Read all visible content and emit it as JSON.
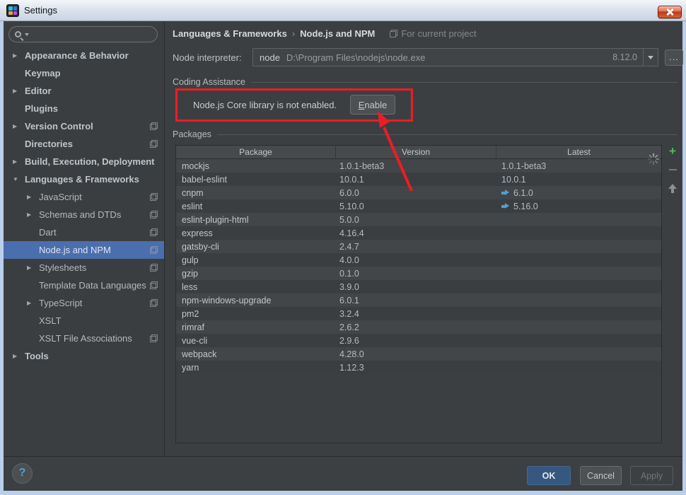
{
  "window": {
    "title": "Settings"
  },
  "sidebar": {
    "items": [
      {
        "label": "Appearance & Behavior",
        "level": 0,
        "bold": true,
        "arrow": "right"
      },
      {
        "label": "Keymap",
        "level": 0,
        "bold": true
      },
      {
        "label": "Editor",
        "level": 0,
        "bold": true,
        "arrow": "right"
      },
      {
        "label": "Plugins",
        "level": 0,
        "bold": true
      },
      {
        "label": "Version Control",
        "level": 0,
        "bold": true,
        "arrow": "right",
        "badge": true
      },
      {
        "label": "Directories",
        "level": 0,
        "bold": true,
        "badge": true
      },
      {
        "label": "Build, Execution, Deployment",
        "level": 0,
        "bold": true,
        "arrow": "right"
      },
      {
        "label": "Languages & Frameworks",
        "level": 0,
        "bold": true,
        "arrow": "down"
      },
      {
        "label": "JavaScript",
        "level": 1,
        "arrow": "right",
        "badge": true
      },
      {
        "label": "Schemas and DTDs",
        "level": 1,
        "arrow": "right",
        "badge": true
      },
      {
        "label": "Dart",
        "level": 1,
        "badge": true
      },
      {
        "label": "Node.js and NPM",
        "level": 1,
        "badge": true,
        "selected": true
      },
      {
        "label": "Stylesheets",
        "level": 1,
        "arrow": "right",
        "badge": true
      },
      {
        "label": "Template Data Languages",
        "level": 1,
        "badge": true
      },
      {
        "label": "TypeScript",
        "level": 1,
        "arrow": "right",
        "badge": true
      },
      {
        "label": "XSLT",
        "level": 1
      },
      {
        "label": "XSLT File Associations",
        "level": 1,
        "badge": true
      },
      {
        "label": "Tools",
        "level": 0,
        "bold": true,
        "arrow": "right"
      }
    ]
  },
  "header": {
    "breadcrumb1": "Languages & Frameworks",
    "separator": "›",
    "breadcrumb2": "Node.js and NPM",
    "scope_note": "For current project"
  },
  "interpreter": {
    "label": "Node interpreter:",
    "name": "node",
    "path": "D:\\Program Files\\nodejs\\node.exe",
    "version": "8.12.0",
    "browse": "..."
  },
  "coding_assistance": {
    "section": "Coding Assistance",
    "message": "Node.js Core library is not enabled.",
    "enable_underline": "E",
    "enable_rest": "nable"
  },
  "packages": {
    "section": "Packages",
    "columns": [
      "Package",
      "Version",
      "Latest"
    ],
    "rows": [
      {
        "package": "mockjs",
        "version": "1.0.1-beta3",
        "latest": "1.0.1-beta3",
        "upgrade": false
      },
      {
        "package": "babel-eslint",
        "version": "10.0.1",
        "latest": "10.0.1",
        "upgrade": false
      },
      {
        "package": "cnpm",
        "version": "6.0.0",
        "latest": "6.1.0",
        "upgrade": true
      },
      {
        "package": "eslint",
        "version": "5.10.0",
        "latest": "5.16.0",
        "upgrade": true
      },
      {
        "package": "eslint-plugin-html",
        "version": "5.0.0",
        "latest": "",
        "upgrade": false
      },
      {
        "package": "express",
        "version": "4.16.4",
        "latest": "",
        "upgrade": false
      },
      {
        "package": "gatsby-cli",
        "version": "2.4.7",
        "latest": "",
        "upgrade": false
      },
      {
        "package": "gulp",
        "version": "4.0.0",
        "latest": "",
        "upgrade": false
      },
      {
        "package": "gzip",
        "version": "0.1.0",
        "latest": "",
        "upgrade": false
      },
      {
        "package": "less",
        "version": "3.9.0",
        "latest": "",
        "upgrade": false
      },
      {
        "package": "npm-windows-upgrade",
        "version": "6.0.1",
        "latest": "",
        "upgrade": false
      },
      {
        "package": "pm2",
        "version": "3.2.4",
        "latest": "",
        "upgrade": false
      },
      {
        "package": "rimraf",
        "version": "2.6.2",
        "latest": "",
        "upgrade": false
      },
      {
        "package": "vue-cli",
        "version": "2.9.6",
        "latest": "",
        "upgrade": false
      },
      {
        "package": "webpack",
        "version": "4.28.0",
        "latest": "",
        "upgrade": false
      },
      {
        "package": "yarn",
        "version": "1.12.3",
        "latest": "",
        "upgrade": false
      }
    ]
  },
  "footer": {
    "help": "?",
    "ok": "OK",
    "cancel": "Cancel",
    "apply": "Apply"
  },
  "colors": {
    "selection": "#4b6eaf",
    "annotation_red": "#ee1c25",
    "ok_blue": "#365880",
    "upgrade_arrow_blue": "#4aa2d9",
    "add_green": "#57b85c",
    "panel_bg": "#3c3f41",
    "window_border": "#b9cfec"
  }
}
